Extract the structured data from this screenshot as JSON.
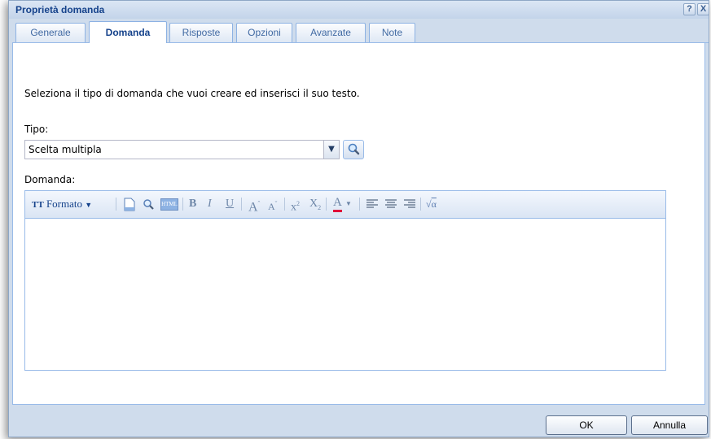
{
  "dialog": {
    "title": "Proprietà domanda",
    "help_label": "?",
    "close_label": "X"
  },
  "tabs": [
    {
      "label": "Generale"
    },
    {
      "label": "Domanda"
    },
    {
      "label": "Risposte"
    },
    {
      "label": "Opzioni"
    },
    {
      "label": "Avanzate"
    },
    {
      "label": "Note"
    }
  ],
  "active_tab": "Domanda",
  "form": {
    "intro": "Seleziona il tipo di domanda che vuoi creare ed inserisci il suo testo.",
    "type_label": "Tipo:",
    "type_value": "Scelta multipla",
    "question_label": "Domanda:",
    "question_value": ""
  },
  "editor_toolbar": {
    "format_label": "Formato",
    "buttons": [
      "new-document",
      "find",
      "html-source",
      "bold",
      "italic",
      "underline",
      "increase-font",
      "decrease-font",
      "superscript",
      "subscript",
      "font-color",
      "align-left",
      "align-center",
      "align-right",
      "formula"
    ]
  },
  "footer": {
    "ok_label": "OK",
    "cancel_label": "Annulla"
  },
  "colors": {
    "accent": "#15428b",
    "frame": "#cfdcec",
    "border": "#99bbe8"
  }
}
